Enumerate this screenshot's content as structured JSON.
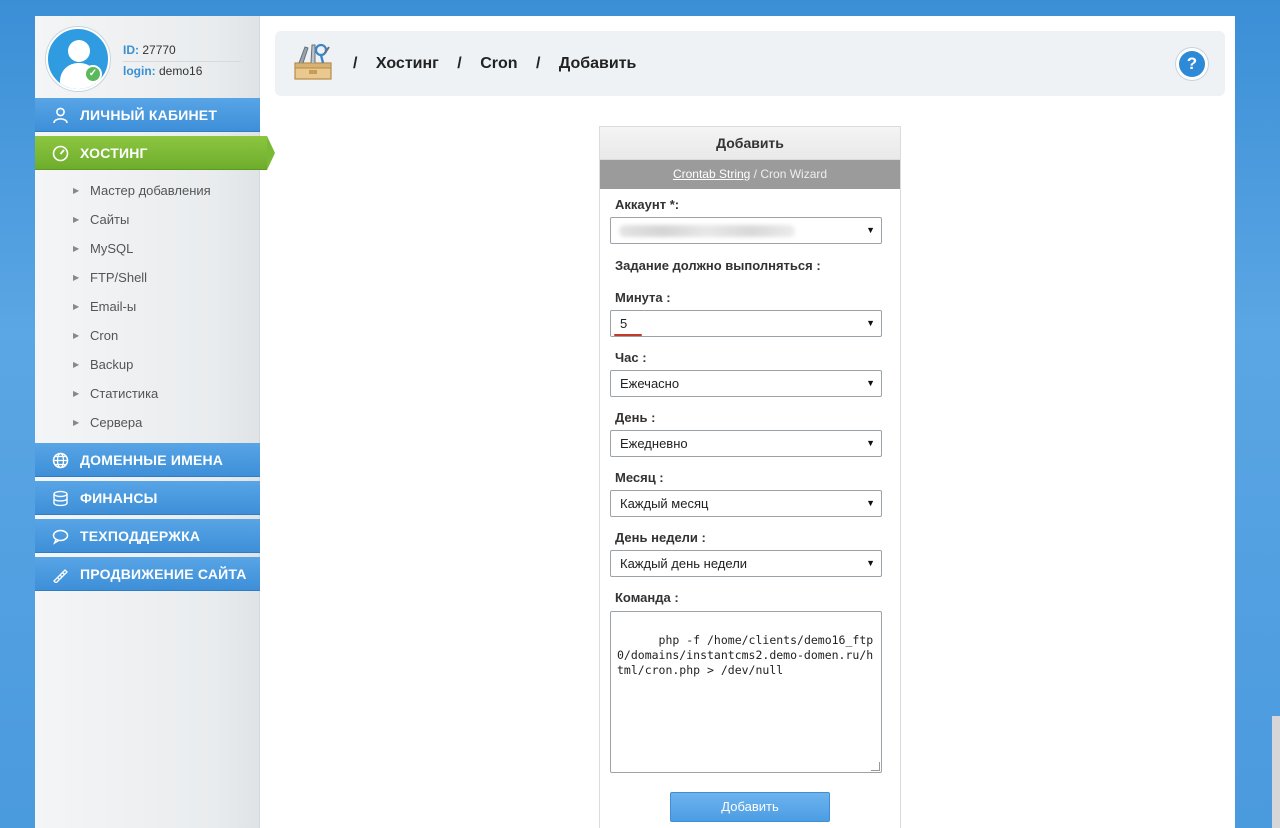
{
  "profile": {
    "id_label": "ID:",
    "id_value": "27770",
    "login_label": "login:",
    "login_value": "demo16"
  },
  "nav": {
    "personal": "ЛИЧНЫЙ КАБИНЕТ",
    "hosting": "ХОСТИНГ",
    "domains": "ДОМЕННЫЕ ИМЕНА",
    "finance": "ФИНАНСЫ",
    "support": "ТЕХПОДДЕРЖКА",
    "promo": "ПРОДВИЖЕНИЕ САЙТА"
  },
  "submenu": [
    "Мастер добавления",
    "Сайты",
    "MySQL",
    "FTP/Shell",
    "Email-ы",
    "Cron",
    "Backup",
    "Статистика",
    "Сервера"
  ],
  "breadcrumb": {
    "sep": "/",
    "items": [
      "Хостинг",
      "Cron",
      "Добавить"
    ]
  },
  "help_label": "?",
  "form": {
    "title": "Добавить",
    "tab_active": "Crontab String",
    "tab_sep": "/",
    "tab_other": "Cron Wizard",
    "account_label": "Аккаунт *:",
    "schedule_label": "Задание должно выполняться :",
    "minute_label": "Минута :",
    "minute_value": "5",
    "hour_label": "Час :",
    "hour_value": "Ежечасно",
    "day_label": "День :",
    "day_value": "Ежедневно",
    "month_label": "Месяц :",
    "month_value": "Каждый месяц",
    "weekday_label": "День недели :",
    "weekday_value": "Каждый день недели",
    "command_label": "Команда :",
    "command_value": "php -f /home/clients/demo16_ftp0/domains/instantcms2.demo-domen.ru/html/cron.php > /dev/null",
    "submit_label": "Добавить"
  },
  "colors": {
    "nav_blue": "#3d8fd8",
    "nav_green": "#7ab934",
    "accent_underline": "#c0392b"
  }
}
